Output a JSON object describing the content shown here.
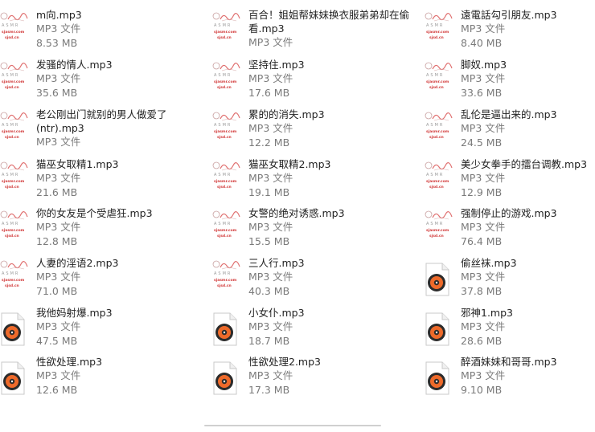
{
  "thumbnail": {
    "asmr_text": "ASMR",
    "asmr_line1": "sjasmr.com",
    "asmr_line2": "sjsd.cn"
  },
  "files": [
    {
      "name": "m向.mp3",
      "type": "MP3 文件",
      "size": "8.53 MB",
      "thumb": "asmr"
    },
    {
      "name": "百合！姐姐帮妹妹换衣服弟弟却在偷看.mp3",
      "type": "MP3 文件",
      "size": "",
      "thumb": "asmr"
    },
    {
      "name": "遠電話勾引朋友.mp3",
      "type": "MP3 文件",
      "size": "8.40 MB",
      "thumb": "asmr"
    },
    {
      "name": "发骚的情人.mp3",
      "type": "MP3 文件",
      "size": "35.6 MB",
      "thumb": "asmr"
    },
    {
      "name": "坚持住.mp3",
      "type": "MP3 文件",
      "size": "17.6 MB",
      "thumb": "asmr"
    },
    {
      "name": "脚奴.mp3",
      "type": "MP3 文件",
      "size": "33.6 MB",
      "thumb": "asmr"
    },
    {
      "name": "老公刚出门就别的男人做爱了(ntr).mp3",
      "type": "MP3 文件",
      "size": "",
      "thumb": "asmr"
    },
    {
      "name": "累的的消失.mp3",
      "type": "MP3 文件",
      "size": "12.2 MB",
      "thumb": "asmr"
    },
    {
      "name": "乱伦是逼出来的.mp3",
      "type": "MP3 文件",
      "size": "24.5 MB",
      "thumb": "asmr"
    },
    {
      "name": "猫巫女取精1.mp3",
      "type": "MP3 文件",
      "size": "21.6 MB",
      "thumb": "asmr"
    },
    {
      "name": "猫巫女取精2.mp3",
      "type": "MP3 文件",
      "size": "19.1 MB",
      "thumb": "asmr"
    },
    {
      "name": "美少女拳手的擂台调教.mp3",
      "type": "MP3 文件",
      "size": "12.9 MB",
      "thumb": "asmr"
    },
    {
      "name": "你的女友是个受虐狂.mp3",
      "type": "MP3 文件",
      "size": "12.8 MB",
      "thumb": "asmr"
    },
    {
      "name": "女警的绝对诱惑.mp3",
      "type": "MP3 文件",
      "size": "15.5 MB",
      "thumb": "asmr"
    },
    {
      "name": "强制停止的游戏.mp3",
      "type": "MP3 文件",
      "size": "76.4 MB",
      "thumb": "asmr"
    },
    {
      "name": "人妻的淫语2.mp3",
      "type": "MP3 文件",
      "size": "71.0 MB",
      "thumb": "asmr"
    },
    {
      "name": "三人行.mp3",
      "type": "MP3 文件",
      "size": "40.3 MB",
      "thumb": "asmr"
    },
    {
      "name": "偷丝袜.mp3",
      "type": "MP3 文件",
      "size": "37.8 MB",
      "thumb": "music"
    },
    {
      "name": "我他妈射爆.mp3",
      "type": "MP3 文件",
      "size": "47.5 MB",
      "thumb": "music"
    },
    {
      "name": "小女仆.mp3",
      "type": "MP3 文件",
      "size": "18.7 MB",
      "thumb": "music"
    },
    {
      "name": "邪神1.mp3",
      "type": "MP3 文件",
      "size": "28.6 MB",
      "thumb": "music"
    },
    {
      "name": "性欲处理.mp3",
      "type": "MP3 文件",
      "size": "12.6 MB",
      "thumb": "music"
    },
    {
      "name": "性欲处理2.mp3",
      "type": "MP3 文件",
      "size": "17.3 MB",
      "thumb": "music"
    },
    {
      "name": "醉酒妹妹和哥哥.mp3",
      "type": "MP3 文件",
      "size": "9.10 MB",
      "thumb": "music"
    }
  ]
}
